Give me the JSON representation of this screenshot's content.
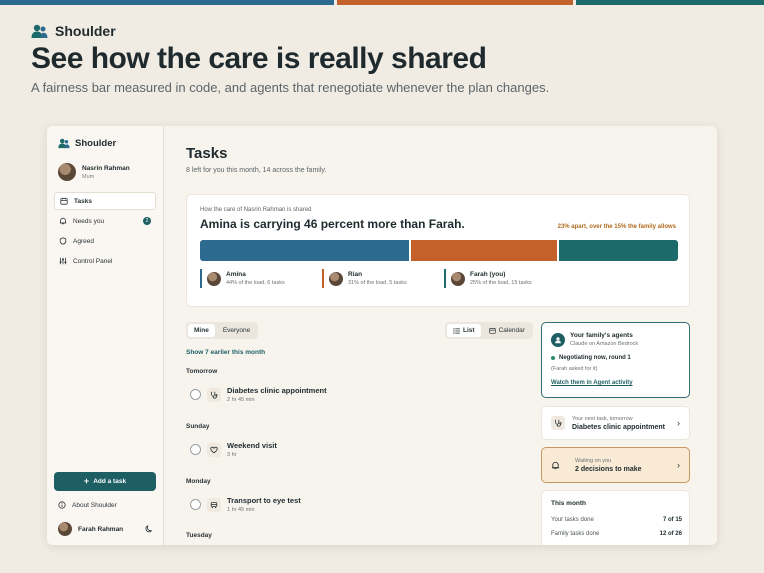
{
  "colors": {
    "amina": "#2d6a8f",
    "rian": "#c4612b",
    "farah": "#1d6a6b",
    "accent": "#1d5f63",
    "warn": "#b06a1e"
  },
  "brand": {
    "name": "Shoulder",
    "icon": "people-icon"
  },
  "hero": {
    "title": "See how the care is really shared",
    "subtitle": "A fairness bar measured in code, and agents that renegotiate whenever the plan changes."
  },
  "sidebar": {
    "brand": "Shoulder",
    "profile": {
      "name": "Nasrin Rahman",
      "role": "Mum"
    },
    "items": [
      {
        "label": "Tasks",
        "icon": "calendar-icon",
        "active": true
      },
      {
        "label": "Needs you",
        "icon": "bell-icon",
        "badge": "2"
      },
      {
        "label": "Agreed",
        "icon": "shield-icon"
      },
      {
        "label": "Control Panel",
        "icon": "sliders-icon"
      }
    ],
    "add_task": "Add a task",
    "about": "About Shoulder",
    "user": "Farah Rahman"
  },
  "main": {
    "title": "Tasks",
    "subtitle": "8 left for you this month, 14 across the family.",
    "share": {
      "caption": "How the care of Nasrin Rahman is shared",
      "headline": "Amina is carrying 46 percent more than Farah.",
      "apart_note": "23% apart, over the 15% the family allows",
      "members": [
        {
          "name": "Amina",
          "detail": "44% of the load, 6 tasks",
          "share": 44
        },
        {
          "name": "Rian",
          "detail": "31% of the load, 5 tasks",
          "share": 31
        },
        {
          "name": "Farah (you)",
          "detail": "25% of the load, 15 tasks",
          "share": 25
        }
      ]
    },
    "filter_tabs": [
      "Mine",
      "Everyone"
    ],
    "view_tabs": [
      "List",
      "Calendar"
    ],
    "show_earlier": "Show 7 earlier this month",
    "days": [
      {
        "label": "Tomorrow",
        "task": {
          "name": "Diabetes clinic appointment",
          "duration": "2 hr 45 min",
          "icon": "stethoscope-icon"
        }
      },
      {
        "label": "Sunday",
        "task": {
          "name": "Weekend visit",
          "duration": "3 hr",
          "icon": "heart-icon"
        }
      },
      {
        "label": "Monday",
        "task": {
          "name": "Transport to eye test",
          "duration": "1 hr 45 min",
          "icon": "car-icon"
        }
      },
      {
        "label": "Tuesday"
      }
    ]
  },
  "agents": {
    "title": "Your family's agents",
    "subtitle": "Claude on Amazon Bedrock",
    "status": "Negotiating now, round 1",
    "note": "(Farah asked for it)",
    "link": "Watch them in Agent activity"
  },
  "next_task": {
    "small": "Your next task, tomorrow",
    "big": "Diabetes clinic appointment"
  },
  "waiting": {
    "small": "Waiting on you",
    "big": "2 decisions to make"
  },
  "month": {
    "title": "This month",
    "rows": [
      {
        "label": "Your tasks done",
        "value": "7 of 15"
      },
      {
        "label": "Family tasks done",
        "value": "12 of 26"
      }
    ]
  }
}
